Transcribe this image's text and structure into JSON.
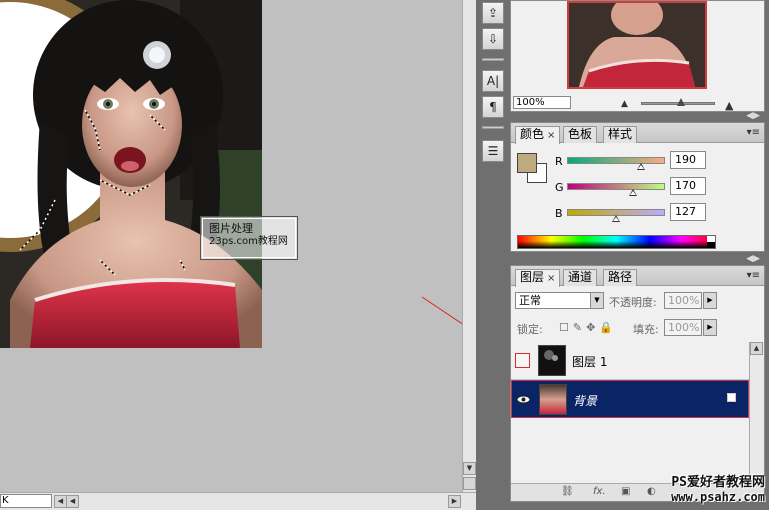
{
  "canvas": {
    "watermark_line1": "图片处理",
    "watermark_line2": "23ps.com教程网",
    "zoom_field": "K"
  },
  "tools": [
    "usb-icon",
    "layers-down-icon",
    "character-icon",
    "paragraph-icon",
    "notes-icon"
  ],
  "tool_glyphs": {
    "character": "A|",
    "paragraph": "¶"
  },
  "navigator": {
    "zoom": "100%"
  },
  "color": {
    "tabs": [
      "颜色",
      "色板",
      "样式"
    ],
    "close_glyph": "×",
    "channels": [
      {
        "name": "R",
        "value": "190",
        "fraction": 0.745
      },
      {
        "name": "G",
        "value": "170",
        "fraction": 0.667
      },
      {
        "name": "B",
        "value": "127",
        "fraction": 0.498
      }
    ],
    "foreground": "#beaa7f",
    "background": "#ffffff"
  },
  "layers": {
    "tabs": [
      "图层",
      "通道",
      "路径"
    ],
    "blend_mode": "正常",
    "opacity_label": "不透明度:",
    "opacity_value": "100%",
    "lock_label": "锁定:",
    "fill_label": "填充:",
    "fill_value": "100%",
    "rows": [
      {
        "name": "图层 1",
        "visible": false,
        "selected": false
      },
      {
        "name": "背景",
        "visible": true,
        "selected": true
      }
    ],
    "footer_fx": "fx."
  },
  "watermark": {
    "line1": "PS爱好者教程网",
    "line2": "www.psahz.com"
  },
  "colors": {
    "panel_bg": "#6f6f6f",
    "selection": "#0a2466",
    "accent_red": "#d23b3b"
  }
}
